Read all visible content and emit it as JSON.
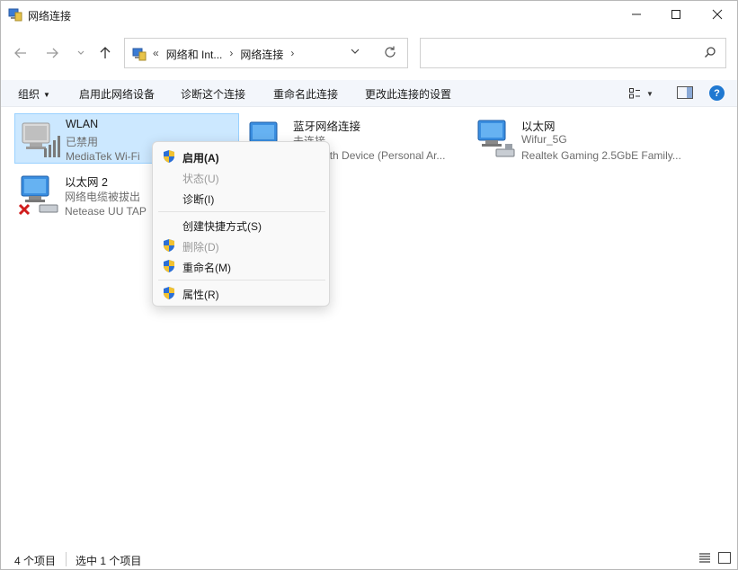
{
  "window": {
    "title": "网络连接",
    "icon": "network-connections-icon"
  },
  "address": {
    "overflow": "«",
    "crumb1": "网络和 Int...",
    "crumb2": "网络连接",
    "chevron": "›"
  },
  "search": {
    "placeholder": ""
  },
  "commands": {
    "organize": "组织",
    "enable_device": "启用此网络设备",
    "diagnose": "诊断这个连接",
    "rename": "重命名此连接",
    "change_settings": "更改此连接的设置"
  },
  "items": [
    {
      "name": "WLAN",
      "status": "已禁用",
      "device": "MediaTek Wi-Fi",
      "icon": "wifi-adapter-icon",
      "selected": true
    },
    {
      "name": "蓝牙网络连接",
      "status": "未连接",
      "device": "Bluetooth Device (Personal Ar...",
      "icon": "bluetooth-network-icon"
    },
    {
      "name": "以太网",
      "status": "Wifur_5G",
      "device": "Realtek Gaming 2.5GbE Family...",
      "icon": "ethernet-adapter-icon"
    },
    {
      "name": "以太网 2",
      "status": "网络电缆被拔出",
      "device": "Netease UU TAP",
      "icon": "ethernet-disconnected-icon"
    }
  ],
  "context_menu": {
    "enable": "启用(A)",
    "status": "状态(U)",
    "diagnose": "诊断(I)",
    "create_shortcut": "创建快捷方式(S)",
    "delete": "删除(D)",
    "rename": "重命名(M)",
    "properties": "属性(R)"
  },
  "statusbar": {
    "count": "4 个项目",
    "selected": "选中 1 个项目"
  },
  "colors": {
    "selection_bg": "#cce8ff",
    "selection_border": "#99d1ff",
    "commandbar_bg": "#f3f6fb",
    "help_blue": "#1f78d1"
  }
}
